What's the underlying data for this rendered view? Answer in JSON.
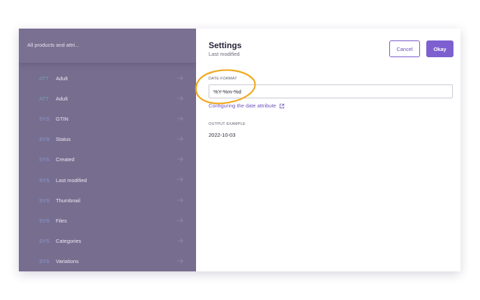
{
  "left_panel": {
    "header": "All products and attri...",
    "items": [
      {
        "tag": "ATT",
        "name": "Adult"
      },
      {
        "tag": "ATT",
        "name": "Adult"
      },
      {
        "tag": "SYS",
        "name": "GTIN"
      },
      {
        "tag": "SYS",
        "name": "Status"
      },
      {
        "tag": "SYS",
        "name": "Created"
      },
      {
        "tag": "SYS",
        "name": "Last modified"
      },
      {
        "tag": "SYS",
        "name": "Thumbnail"
      },
      {
        "tag": "SYS",
        "name": "Files"
      },
      {
        "tag": "SYS",
        "name": "Categories"
      },
      {
        "tag": "SYS",
        "name": "Variations"
      }
    ]
  },
  "settings": {
    "title": "Settings",
    "subtitle": "Last modified",
    "cancel_label": "Cancel",
    "okay_label": "Okay",
    "date_format_label": "DATE FORMAT",
    "date_format_value": "%Y-%m-%d",
    "config_link": "Configuring the date attribute",
    "output_label": "OUTPUT EXAMPLE",
    "output_value": "2022-10-03"
  },
  "colors": {
    "accent": "#7d5fd0",
    "overlay": "#776d8f",
    "annotation": "#f0a81c"
  },
  "icons": {
    "row_arrow": "arrow-right-icon",
    "external_link": "external-link-icon"
  }
}
